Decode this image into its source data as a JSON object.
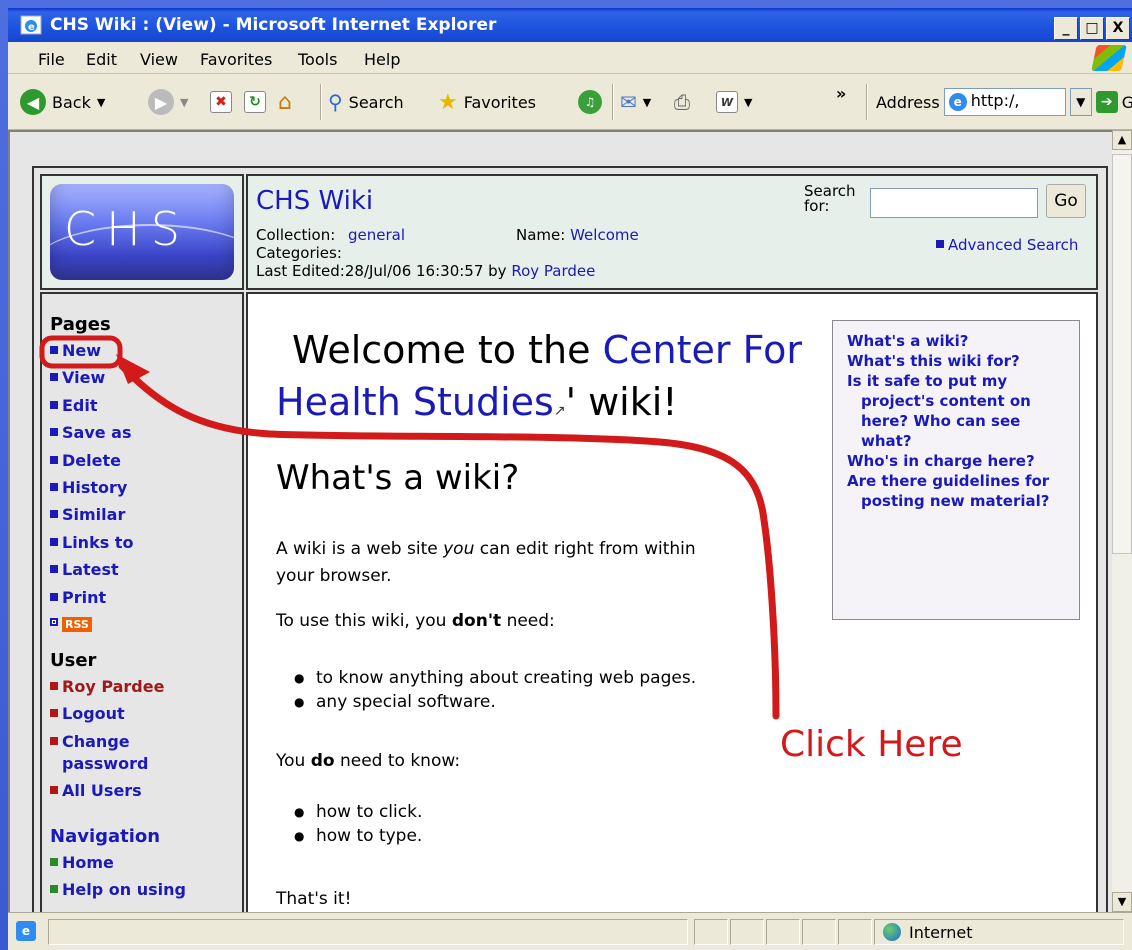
{
  "window": {
    "title": "CHS Wiki : (View) - Microsoft Internet Explorer",
    "controls": {
      "minimize": "_",
      "maximize": "□",
      "close": "X"
    }
  },
  "menu": [
    "File",
    "Edit",
    "View",
    "Favorites",
    "Tools",
    "Help"
  ],
  "toolbar": {
    "back": "Back",
    "search": "Search",
    "favorites": "Favorites",
    "overflow": "»",
    "address_label": "Address",
    "address_value": "http:/,",
    "go": "Go"
  },
  "status": {
    "zone": "Internet"
  },
  "header": {
    "logo_text": "CHS",
    "site_title": "CHS Wiki",
    "collection_label": "Collection:",
    "collection_value": "general",
    "name_label": "Name:",
    "name_value": "Welcome",
    "categories_label": "Categories:",
    "last_edited": "Last Edited:28/Jul/06 16:30:57 by",
    "last_edited_by": "Roy Pardee",
    "search_label_1": "Search",
    "search_label_2": "for:",
    "search_go": "Go",
    "advanced_search": "Advanced Search"
  },
  "sidebar": {
    "pages_heading": "Pages",
    "pages": [
      "New",
      "View",
      "Edit",
      "Save as",
      "Delete",
      "History",
      "Similar",
      "Links to",
      "Latest",
      "Print"
    ],
    "rss": "RSS",
    "user_heading": "User",
    "user_items": [
      "Roy Pardee",
      "Logout",
      "Change password",
      "All Users"
    ],
    "nav_heading": "Navigation",
    "nav_items": [
      "Home",
      "Help on using"
    ]
  },
  "content": {
    "welcome_1": "Welcome to the",
    "welcome_link": "Center For Health Studies",
    "welcome_2": "' wiki!",
    "heading": "What's a wiki?",
    "p1_a": "A wiki is a web site",
    "p1_em": "you",
    "p1_b": "can edit right from within",
    "p1_c": "your browser.",
    "p2_a": "To use this wiki, you",
    "p2_strong": "don't",
    "p2_b": "need:",
    "need_not": [
      "to know anything about creating web pages.",
      "any special software."
    ],
    "p3_a": "You",
    "p3_strong": "do",
    "p3_b": "need to know:",
    "need": [
      "how to click.",
      "how to type."
    ],
    "p4": "That's it!"
  },
  "toc": [
    "What's a wiki?",
    "What's this wiki for?",
    "Is it safe to put my project's content on here? Who can see what?",
    "Who's in charge here?",
    "Are there guidelines for posting new material?"
  ],
  "annotation": {
    "text": "Click Here",
    "color": "#d21a1a"
  },
  "colors": {
    "link": "#1a1ab8",
    "pages_bullet": "#1a1ab8",
    "user_bullet": "#b01818",
    "nav_bullet": "#2a8a2a",
    "user_text": "#a01818"
  }
}
